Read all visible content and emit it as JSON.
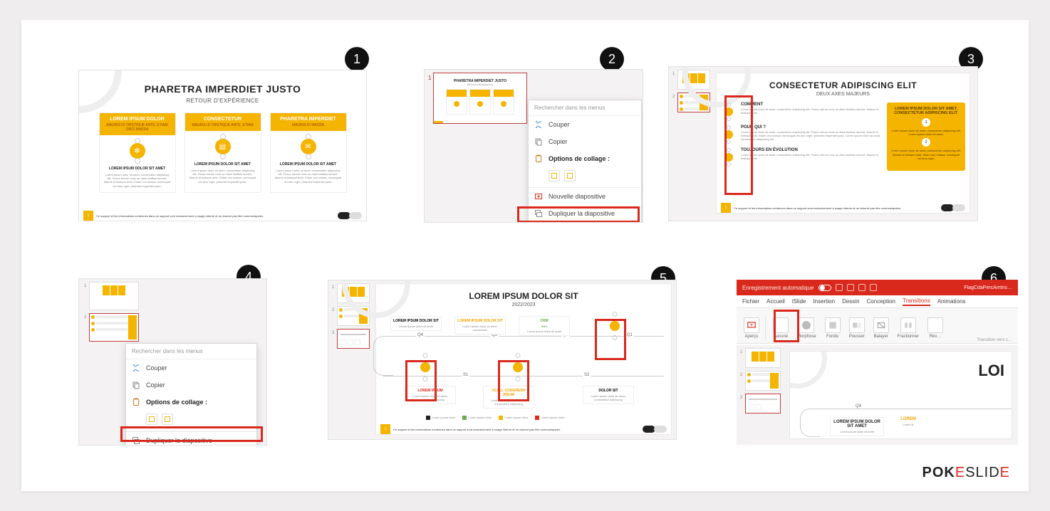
{
  "badges": {
    "s1": "1",
    "s2": "2",
    "s3": "3",
    "s4": "4",
    "s5": "5",
    "s6": "6"
  },
  "logo": {
    "part1": "POK",
    "part2": "E",
    "part3": "SLID",
    "part4": "E"
  },
  "slide1": {
    "title": "PHARETRA IMPERDIET JUSTO",
    "subtitle": "RETOUR D'EXPÉRIENCE",
    "footer_page": "1",
    "footer_text": "Ce support et les informations contenues dans ce support sont exclusivement à usage interne et ne doivent pas être communiquées.",
    "cards": [
      {
        "h": "LOREM IPSUM DOLOR",
        "sub": "MAURIS ID TRISTIQUE ANTE, ETIAM ORCI MASSA",
        "body_h": "LOREM IPSUM DOLOR SIT AMET",
        "body": "Lorem ipsum dolor sit amet, consectetur adipiscing elit. Fusce rutrum nunc ac diam facilisis laoreet. Mauris id tristique ante. Etiam orci massa, consequat vel arcu eget, pharetra imperdiet justo."
      },
      {
        "h": "CONSECTETUR",
        "sub": "MAURIS ID TRISTIQUE ANTE, ETIAM",
        "body_h": "LOREM IPSUM DOLOR SIT AMET",
        "body": "Lorem ipsum dolor sit amet, consectetur adipiscing elit. Fusce rutrum nunc ac diam facilisis laoreet. Mauris id tristique ante. Etiam orci massa, consequat vel arcu eget, pharetra imperdiet justo."
      },
      {
        "h": "PHARETRA IMPERDIET",
        "sub": "MAURIS ID MASSA",
        "body_h": "LOREM IPSUM DOLOR SIT AMET",
        "body": "Lorem ipsum dolor sit amet, consectetur adipiscing elit. Fusce rutrum nunc ac diam facilisis laoreet. Mauris id tristique ante. Etiam orci massa, consequat vel arcu eget, pharetra imperdiet justo."
      }
    ]
  },
  "context_menu": {
    "search": "Rechercher dans les menus",
    "cut": "Couper",
    "copy": "Copier",
    "paste_opts": "Options de collage :",
    "new_slide": "Nouvelle diapositive",
    "duplicate": "Dupliquer la diapositive"
  },
  "panel2": {
    "thumb_title": "PHARETRA IMPERDIET JUSTO",
    "thumb1_num": "1"
  },
  "panel3": {
    "title": "CONSECTETUR ADIPISCING ELIT",
    "subtitle": "DEUX AXES MAJEURS",
    "thumbs": {
      "n1": "1",
      "n2": "2"
    },
    "items": [
      {
        "h": "COMMENT",
        "p": "Lorem ipsum dolor sit amet, consectetur adipiscing elit. Fusce rutrum nunc ac diam facilisis laoreet. Mauris id tristique ante."
      },
      {
        "h": "POUR QUI ?",
        "p": "Lorem ipsum dolor sit amet, consectetur adipiscing elit. Fusce rutrum nunc ac diam facilisis laoreet. Mauris id tristique ante. Etiam orci massa, consequat vel arcu eget, pharetra imperdiet justo.\nLorem ipsum dolor sit amet, consectetur adipiscing elit."
      },
      {
        "h": "TOUJOURS EN ÉVOLUTION",
        "p": "Lorem ipsum dolor sit amet, consectetur adipiscing elit. Fusce rutrum nunc ac diam facilisis laoreet. Mauris id tristique ante."
      }
    ],
    "right": {
      "h": "LOREM IPSUM DOLOR SIT AMET, CONSECTETUR ADIPISCING ELIT.",
      "n1": "1",
      "p1": "Lorem ipsum dolor sit amet, consectetur adipiscing elit. Lorem ipsum dolor sit amet.",
      "n2": "2",
      "p2": "Lorem ipsum dolor sit amet, consectetur adipiscing elit. Mauris id tristique ante. Etiam orci massa, consequat vel arcu eget."
    }
  },
  "panel4": {
    "thumbs": {
      "n1": "1",
      "n2": "2"
    }
  },
  "panel5": {
    "title": "LOREM IPSUM DOLOR SIT",
    "subtitle": "2022/2023",
    "q": {
      "q4": "Q4",
      "q1": "Q1",
      "q2": "Q2",
      "q3": "Q3",
      "s1": "S1",
      "s2": "S2"
    },
    "boxes": {
      "a": {
        "h": "LOREM IPSUM DOLOR SIT",
        "p": "Lorem ipsum dolor sit amet"
      },
      "b": {
        "h": "LOREM IPSUM DOLOR SIT",
        "p": "Lorem ipsum dolor sit amet, consectetur"
      },
      "c": {
        "h": "CRM",
        "sub": "XXX",
        "p": "Lorem ipsum dolor sit amet"
      },
      "d": {
        "h": "LOREM IPSUM",
        "p": "Lorem ipsum dolor sit amet, consectetur adipiscing"
      },
      "e": {
        "h": "VCALL CONGRESH IPSUM",
        "p": "Lorem ipsum dolor sit amet, consectetur adipiscing"
      },
      "f": {
        "h": "DOLOR SIT",
        "p": "Lorem ipsum dolor sit amet, consectetur adipiscing"
      }
    },
    "legend": {
      "l1": "Lorem ipsum dolor",
      "l2": "Lorem ipsum dolor",
      "l3": "Lorem ipsum dolor",
      "l4": "Lorem ipsum dolor"
    },
    "thumbs": {
      "n1": "1",
      "n2": "2",
      "n3": "3"
    }
  },
  "panel6": {
    "titlebar": {
      "auto": "Enregistrement automatique",
      "doc": "FlagCdaPercAmtris…"
    },
    "menu": {
      "fichier": "Fichier",
      "accueil": "Accueil",
      "slide": "iSlide",
      "insertion": "Insertion",
      "dessin": "Dessin",
      "conception": "Conception",
      "transitions": "Transitions",
      "animations": "Animations"
    },
    "ribbon": {
      "apercu": "Aperçu",
      "aucune": "Aucune",
      "morph": "Morphose",
      "fondu": "Fondu",
      "pousser": "Pousser",
      "balayer": "Balayer",
      "fraction": "Fractionner",
      "rev": "Rév…",
      "group": "Aperçu",
      "trans": "Transition vers c…"
    },
    "stage": {
      "title": "LOI",
      "q4": "Q4",
      "boxa_h": "LOREM IPSUM DOLOR SIT AMET",
      "boxa_p": "Lorem ipsum dolor sit amet",
      "boxb_h": "LOREM",
      "boxb_p": "Lorem ip"
    },
    "thumbs": {
      "n1": "1",
      "n2": "2",
      "n3": "3"
    }
  }
}
